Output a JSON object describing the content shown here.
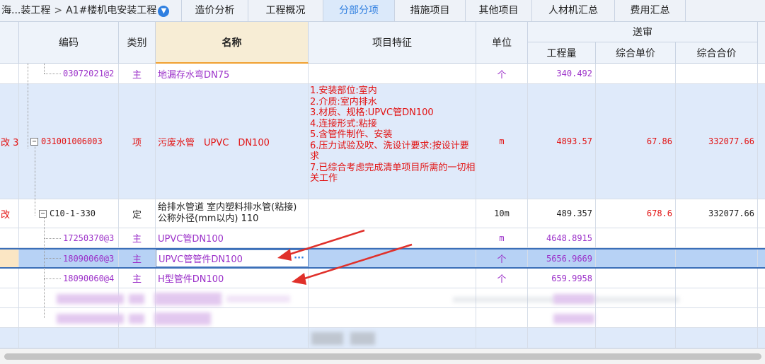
{
  "breadcrumb": {
    "parent": "海...装工程",
    "separator": ">",
    "current": "A1#楼机电安装工程"
  },
  "tabs": [
    {
      "label": "造价分析",
      "active": false
    },
    {
      "label": "工程概况",
      "active": false
    },
    {
      "label": "分部分项",
      "active": true
    },
    {
      "label": "措施项目",
      "active": false
    },
    {
      "label": "其他项目",
      "active": false
    },
    {
      "label": "人材机汇总",
      "active": false
    },
    {
      "label": "费用汇总",
      "active": false
    }
  ],
  "header": {
    "code": "编码",
    "type": "类别",
    "name": "名称",
    "features": "项目特征",
    "unit": "单位",
    "group": "送审",
    "qty": "工程量",
    "price": "综合单价",
    "total": "综合合价"
  },
  "rows": [
    {
      "num": "",
      "code": "03072021@2",
      "type": "主",
      "name": "地漏存水弯DN75",
      "features": "",
      "unit": "个",
      "qty": "340.492",
      "price": "",
      "total": ""
    },
    {
      "num": "改 3",
      "code": "031001006003",
      "type": "项",
      "name": "污废水管　UPVC　DN100",
      "features": [
        "1.安装部位:室内",
        "2.介质:室内排水",
        "3.材质、规格:UPVC管DN100",
        "4.连接形式:粘接",
        "5.含管件制作、安装",
        "6.压力试验及吹、洗设计要求:按设计要求",
        "7.已综合考虑完成清单项目所需的一切相关工作"
      ],
      "unit": "m",
      "qty": "4893.57",
      "price": "67.86",
      "total": "332077.66"
    },
    {
      "num": "改",
      "code": "C10-1-330",
      "type": "定",
      "name": "给排水管道 室内塑料排水管(粘接) 公称外径(mm以内) 110",
      "features": "",
      "unit": "10m",
      "qty": "489.357",
      "price": "678.6",
      "total": "332077.66"
    },
    {
      "num": "",
      "code": "17250370@3",
      "type": "主",
      "name": "UPVC管DN100",
      "features": "",
      "unit": "m",
      "qty": "4648.8915",
      "price": "",
      "total": ""
    },
    {
      "num": "",
      "code": "18090060@3",
      "type": "主",
      "name": "UPVC管管件DN100",
      "features": "",
      "unit": "个",
      "qty": "5656.9669",
      "price": "",
      "total": "",
      "more": "···"
    },
    {
      "num": "",
      "code": "18090060@4",
      "type": "主",
      "name": "H型管件DN100",
      "features": "",
      "unit": "个",
      "qty": "659.9958",
      "price": "",
      "total": ""
    }
  ],
  "colors": {
    "accent": "#2f7fe0",
    "purple_text": "#9b30c9",
    "red_text": "#e21212",
    "selected_row": "#b7d2f5",
    "item_row": "#dfeafa",
    "arrow": "#e0302a"
  }
}
